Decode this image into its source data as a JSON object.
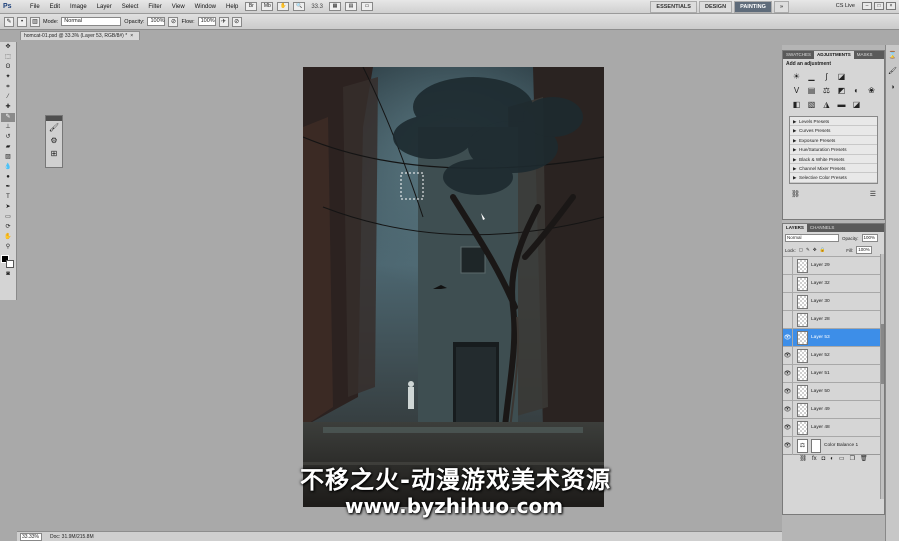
{
  "app": {
    "logo": "Ps",
    "menus": [
      "File",
      "Edit",
      "Image",
      "Layer",
      "Select",
      "Filter",
      "View",
      "Window",
      "Help"
    ],
    "zoom_display": "33.3",
    "workspaces": [
      "ESSENTIALS",
      "DESIGN",
      "PAINTING"
    ],
    "active_workspace": "PAINTING",
    "more_workspaces": "»",
    "cs_live": "CS Live"
  },
  "options_bar": {
    "mode_label": "Mode:",
    "mode_value": "Normal",
    "opacity_label": "Opacity:",
    "opacity_value": "100%",
    "flow_label": "Flow:",
    "flow_value": "100%"
  },
  "document": {
    "tab_title": "homcat-01.psd @ 33.3% (Layer 53, RGB/8#) *",
    "tab_close": "×"
  },
  "watermark": {
    "line1": "不移之火-动漫游戏美术资源",
    "line2": "www.byzhihuo.com"
  },
  "status": {
    "zoom": "33.33%",
    "doc_info": "Doc: 31.9M/215.8M"
  },
  "adjustments_panel": {
    "tabs": [
      "SWATCHES",
      "ADJUSTMENTS",
      "MASKS"
    ],
    "active_tab": "ADJUSTMENTS",
    "title": "Add an adjustment",
    "presets": [
      "Levels Presets",
      "Curves Presets",
      "Exposure Presets",
      "Hue/Saturation Presets",
      "Black & White Presets",
      "Channel Mixer Presets",
      "Selective Color Presets"
    ]
  },
  "layers_panel": {
    "tabs": [
      "LAYERS",
      "CHANNELS"
    ],
    "active_tab": "LAYERS",
    "blend_mode": "Normal",
    "opacity_label": "Opacity:",
    "opacity_value": "100%",
    "lock_label": "Lock:",
    "fill_label": "Fill:",
    "fill_value": "100%",
    "layers": [
      {
        "name": "Layer 29",
        "visible": false,
        "selected": false
      },
      {
        "name": "Layer 32",
        "visible": false,
        "selected": false
      },
      {
        "name": "Layer 30",
        "visible": false,
        "selected": false
      },
      {
        "name": "Layer 28",
        "visible": false,
        "selected": false
      },
      {
        "name": "Layer 53",
        "visible": true,
        "selected": true
      },
      {
        "name": "Layer 52",
        "visible": true,
        "selected": false
      },
      {
        "name": "Layer 51",
        "visible": true,
        "selected": false
      },
      {
        "name": "Layer 50",
        "visible": true,
        "selected": false
      },
      {
        "name": "Layer 49",
        "visible": true,
        "selected": false
      },
      {
        "name": "Layer 48",
        "visible": true,
        "selected": false
      },
      {
        "name": "Color Balance 1",
        "visible": true,
        "selected": false
      }
    ]
  }
}
